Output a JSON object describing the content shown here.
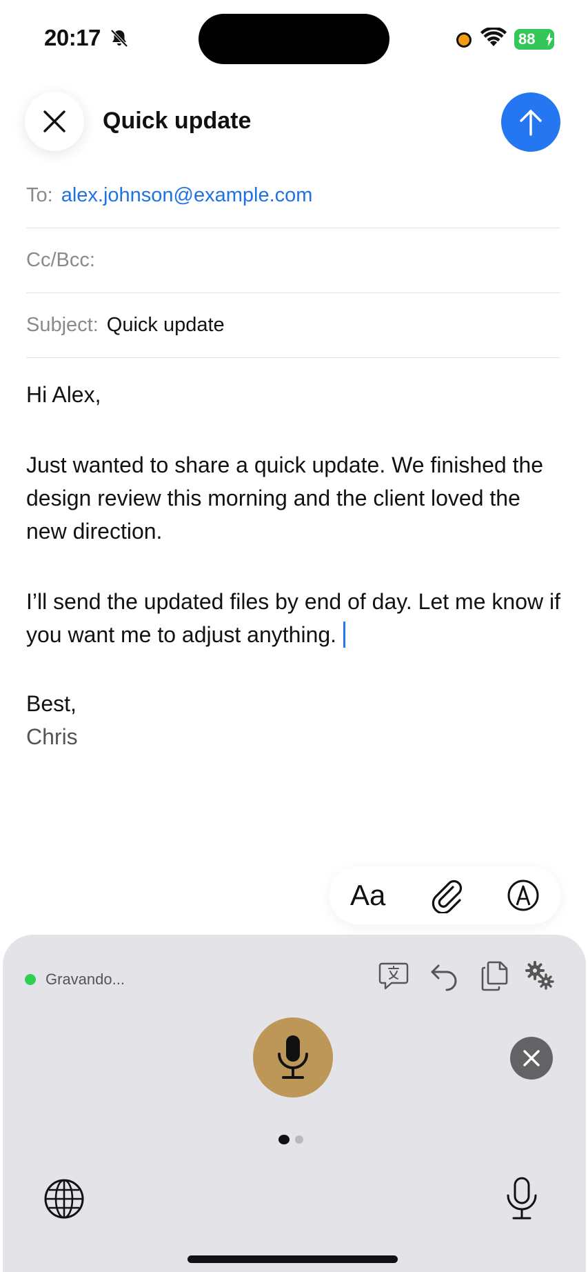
{
  "status_bar": {
    "time": "20:17",
    "battery": "88",
    "icons": [
      "bell-slash-icon",
      "recording-dot-icon",
      "wifi-icon",
      "battery-charging-icon"
    ]
  },
  "compose": {
    "title": "Quick update",
    "close_icon": "close-icon",
    "send_icon": "arrow-up-icon",
    "accent_color": "#2477f0"
  },
  "fields": {
    "to_label": "To:",
    "to_value": "alex.johnson@example.com",
    "cc_label": "Cc/Bcc:",
    "subject_label": "Subject:",
    "subject_value": "Quick update"
  },
  "body": {
    "greeting": "Hi Alex,",
    "paragraph1": "Just wanted to share a quick update. We finished the design review this morning and the client loved the new direction.",
    "paragraph2": "I’ll send the updated files by end of day. Let me know if you want me to adjust anything.",
    "signoff": "Best,",
    "name": "Chris"
  },
  "format_toolbar": {
    "text_format_label": "Aa",
    "icons": [
      "paperclip-icon",
      "markup-icon"
    ]
  },
  "keyboard": {
    "recording_label": "Gravando...",
    "recording_color": "#2fcf53",
    "mic_color": "#bc9757",
    "tools": [
      "translate-icon",
      "undo-icon",
      "copy-icon",
      "settings-icon"
    ],
    "page_indicator": {
      "current": 1,
      "total": 2
    },
    "bottom_icons": [
      "globe-icon",
      "microphone-icon"
    ]
  }
}
